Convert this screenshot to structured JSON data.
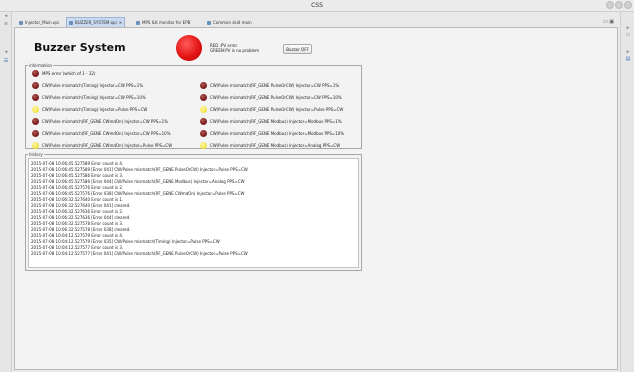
{
  "window": {
    "title": "CSS"
  },
  "tabs": [
    {
      "label": "Injector_Main.opi",
      "active": false
    },
    {
      "label": "BUZZER_SYSTEM.opi",
      "active": true
    },
    {
      "label": "MPS ILK monitor for EPB",
      "active": false
    },
    {
      "label": "Common skid main",
      "active": false
    }
  ],
  "tab_controls": "▭ ▣",
  "colors": {
    "led_red": "#e31414",
    "led_dark_red": "#7e1e1e",
    "led_yellow": "#f2e74d",
    "active_tab": "#c9daf1"
  },
  "header": {
    "title": "Buzzer System",
    "legend_red": "RED    :PV error",
    "legend_green": "GREEN:PV is no problem",
    "buzzer_off_label": "Buzzer OFF"
  },
  "information": {
    "label": "information",
    "mps_error": {
      "text": "MPS error (which of 1 - 32)",
      "state": "red"
    },
    "left": [
      {
        "text": "CW/Pulse mismatch(Timing)   Injector=CW PPS=1%",
        "state": "red"
      },
      {
        "text": "CW/Pulse mismatch(Timing)   Injector=CW PPS=10%",
        "state": "red"
      },
      {
        "text": "CW/Pulse mismatch(Timing)   Injector=Pulse PPS=CW",
        "state": "yellow"
      },
      {
        "text": "CW/Pulse mismatch(RF_GENE CWmdOn)   Injector=CW PPS=1%",
        "state": "red"
      },
      {
        "text": "CW/Pulse mismatch(RF_GENE CWmdOn)   Injector=CW PPS=10%",
        "state": "red"
      },
      {
        "text": "CW/Pulse mismatch(RF_GENE CWmdOn)   Injector=Pulse PPS=CW",
        "state": "yellow"
      }
    ],
    "right": [
      {
        "text": "CW/Pulse mismatch(RF_GENE PulseOrCW)   Injector=CW PPS=1%",
        "state": "red"
      },
      {
        "text": "CW/Pulse mismatch(RF_GENE PulseOrCW)   Injector=CW PPS=10%",
        "state": "red"
      },
      {
        "text": "CW/Pulse mismatch(RF_GENE PulseOrCW)   Injector=Pulse PPS=CW",
        "state": "yellow"
      },
      {
        "text": "CW/Pulse mismatch(RF_GENE Modbus)   Injector=Modbus PPS=1%",
        "state": "red"
      },
      {
        "text": "CW/Pulse mismatch(RF_GENE Modbus)   Injector=Modbus PPS=10%",
        "state": "red"
      },
      {
        "text": "CW/Pulse mismatch(RF_GENE Modbus)   Injector=Analog PPS=CW",
        "state": "yellow"
      }
    ]
  },
  "history": {
    "label": "history",
    "lines": [
      "2015-07-08 10:06:45.527589 Error count is 4.",
      "2015-07-08 10:06:45.527589 [Error 041] CW/Pulse mismatch(RF_GENE PulseOrCW)    Injector=Pulse PPS=CW",
      "2015-07-08 10:06:45.527586 Error count is 3.",
      "2015-07-08 10:06:45.527586 [Error 044] CW/Pulse mismatch(RF_GENE Modbus)    Injector=Analog PPS=CW",
      "2015-07-08 10:06:45.527576 Error count is 2.",
      "2015-07-08 10:06:45.527576 [Error 038] CW/Pulse mismatch(RF_GENE CWmdOn)    Injector=Pulse PPS=CW",
      "2015-07-08 10:06:32.527640 Error count is 1.",
      "2015-07-08 10:06:32.527640 [Error 041] cleared.",
      "2015-07-08 10:06:32.527636 Error count is 2.",
      "2015-07-08 10:06:32.527636 [Error 044] cleared.",
      "2015-07-08 10:06:32.527578 Error count is 3.",
      "2015-07-08 10:06:32.527578 [Error 038] cleared.",
      "2015-07-08 10:04:12.527579 Error count is 4.",
      "2015-07-08 10:04:12.527579 [Error 035] CW/Pulse mismatch(Timing)    Injector=Pulse PPS=CW",
      "2015-07-08 10:04:12.527577 Error count is 3.",
      "2015-07-08 10:04:12.527577 [Error 041] CW/Pulse mismatch(RF_GENE PulseOrCW)    Injector=Pulse PPS=CW"
    ]
  }
}
